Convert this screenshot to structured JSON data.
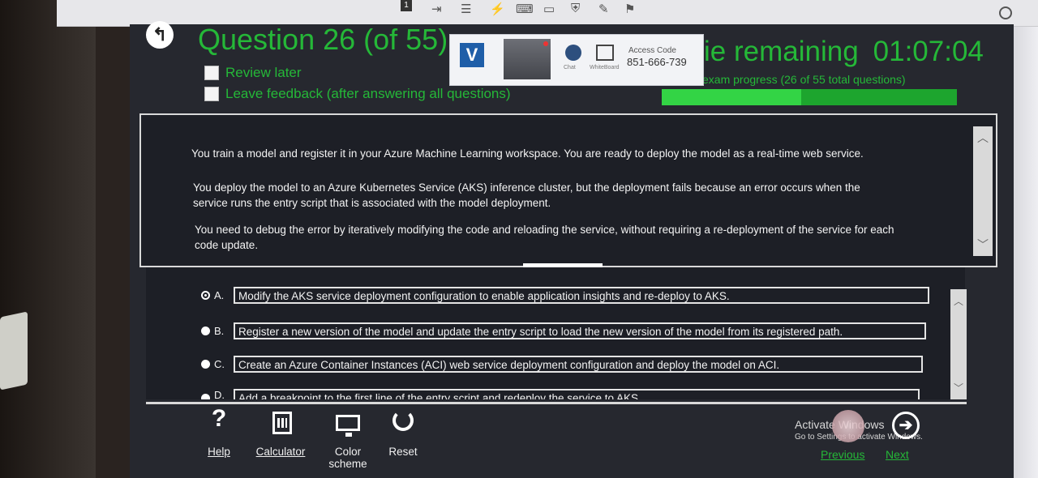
{
  "header": {
    "question_title": "Question 26 (of 55)",
    "review_later": "Review later",
    "leave_feedback": "Leave feedback (after answering all questions)",
    "time_remaining_label": "ie remaining",
    "time_remaining_value": "01:07:04",
    "exam_progress": "exam progress (26 of 55 total questions)",
    "progress_fraction": 0.473
  },
  "proctor": {
    "logo": "V",
    "chat_label": "Chat",
    "whiteboard_label": "WhiteBoard",
    "access_label": "Access Code",
    "access_code": "851-666-739"
  },
  "question": {
    "p1": "You train a model and register it in your Azure Machine Learning workspace. You are ready to deploy the model as a real-time web service.",
    "p2": "You deploy the model to an Azure Kubernetes Service (AKS) inference cluster, but the deployment fails because an error occurs when the service runs the entry script that is associated with the model deployment.",
    "p3": "You need to debug the error by iteratively modifying the code and reloading the service, without requiring a re-deployment of the service for each code update."
  },
  "options": [
    {
      "letter": "A.",
      "text": "Modify the AKS service deployment configuration to enable application insights and re-deploy to AKS."
    },
    {
      "letter": "B.",
      "text": "Register a new version of the model and update the entry script to load the new version of the model from its registered path."
    },
    {
      "letter": "C.",
      "text": "Create an Azure Container Instances (ACI) web service deployment configuration and deploy the model on ACI."
    },
    {
      "letter": "D.",
      "text": "Add a breakpoint to the first line of the entry script and redeploy the service to AKS."
    }
  ],
  "toolbar": {
    "help": "Help",
    "calculator": "Calculator",
    "color_scheme": "Color scheme",
    "reset": "Reset",
    "previous": "Previous",
    "next": "Next"
  },
  "watermark": {
    "activate": "Activate Windows",
    "go_to_settings": "Go to Settings to activate Windows."
  },
  "browser_toolbar": {
    "badge": "1"
  }
}
